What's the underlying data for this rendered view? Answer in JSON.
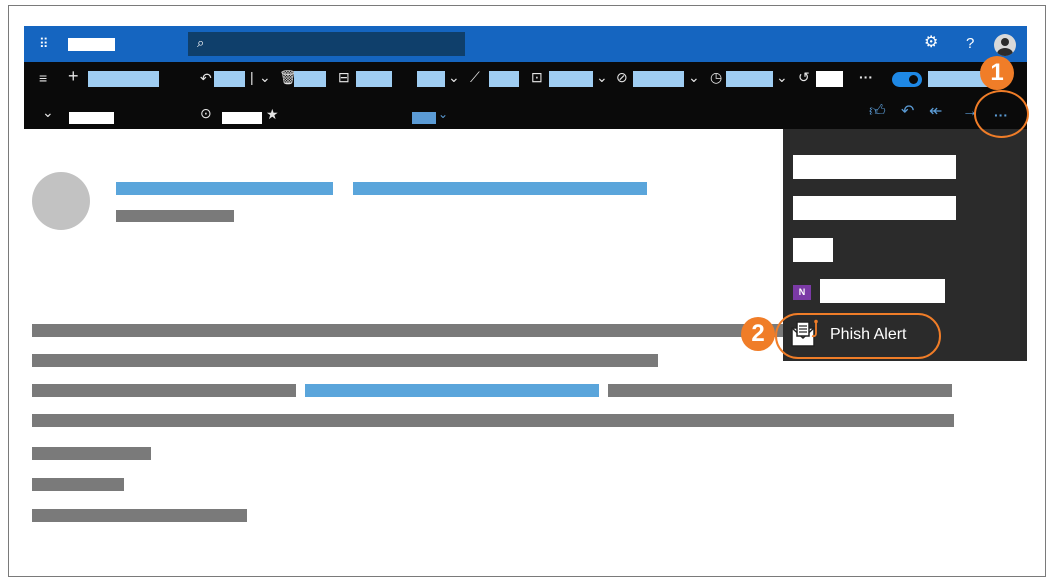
{
  "topbar": {
    "search_icon": "search-icon",
    "settings_icon": "gear-icon",
    "help_label": "?",
    "avatar_icon": "avatar-icon",
    "waffle_icon": "waffle-icon"
  },
  "commandbar": {
    "more_label": "···"
  },
  "subbar": {
    "more_label": "···"
  },
  "menu": {
    "phish_alert_label": "Phish Alert"
  },
  "callouts": {
    "step1": "1",
    "step2": "2"
  },
  "colors": {
    "accent": "#1565c0",
    "callout": "#f07d28",
    "menu_bg": "#2b2b2b"
  }
}
